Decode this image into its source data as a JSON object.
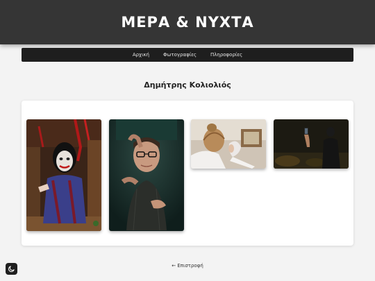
{
  "header": {
    "title": "ΜΕΡΑ & ΝΥΧΤΑ"
  },
  "nav": {
    "items": [
      {
        "label": "Αρχική"
      },
      {
        "label": "Φωτογραφίες"
      },
      {
        "label": "Πληροφορίες"
      }
    ]
  },
  "page": {
    "title": "Δημήτρης Κολιολιός"
  },
  "gallery": {
    "photos": [
      {
        "subject": "person-clown-makeup"
      },
      {
        "subject": "man-with-glasses"
      },
      {
        "subject": "person-hair-bun-with-hands"
      },
      {
        "subject": "person-with-phone-dark"
      }
    ]
  },
  "footer": {
    "back_label": "← Επιστροφή"
  },
  "theme_toggle": {
    "icon": "moon-icon"
  }
}
